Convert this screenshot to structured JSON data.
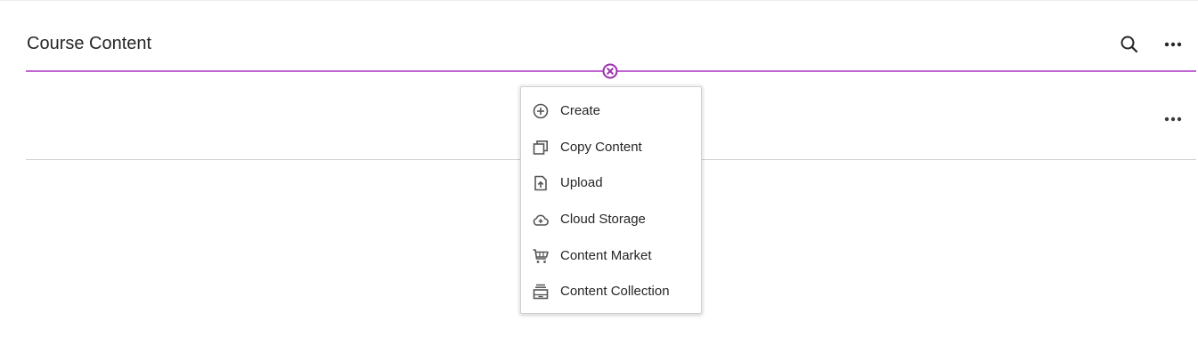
{
  "header": {
    "title": "Course Content",
    "search_icon": "search-icon",
    "more_icon": "more-options-icon"
  },
  "insert_bar": {
    "color": "#c165d1",
    "close_icon": "close-circle-icon"
  },
  "row": {
    "more_icon": "more-options-icon"
  },
  "add_menu": {
    "items": [
      {
        "label": "Create",
        "icon": "plus-circle-icon"
      },
      {
        "label": "Copy Content",
        "icon": "copy-icon"
      },
      {
        "label": "Upload",
        "icon": "upload-icon"
      },
      {
        "label": "Cloud Storage",
        "icon": "cloud-storage-icon"
      },
      {
        "label": "Content Market",
        "icon": "cart-icon"
      },
      {
        "label": "Content Collection",
        "icon": "collection-icon"
      }
    ]
  }
}
